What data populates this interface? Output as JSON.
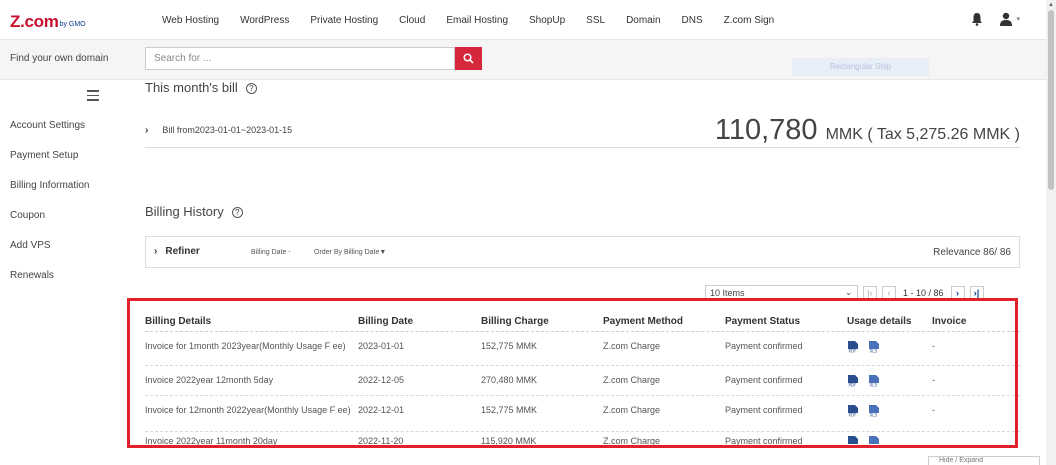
{
  "logo": {
    "main": "Z.com",
    "sub": "by GMO"
  },
  "nav": [
    "Web Hosting",
    "WordPress",
    "Private Hosting",
    "Cloud",
    "Email Hosting",
    "ShopUp",
    "SSL",
    "Domain",
    "DNS",
    "Z.com Sign"
  ],
  "top_icons": {
    "bell": "bell-icon",
    "user": "user-icon"
  },
  "search": {
    "label": "Find your own domain",
    "placeholder": "Search for ...",
    "faded_button": "Rectangular Ship"
  },
  "sidebar": [
    "Account Settings",
    "Payment Setup",
    "Billing Information",
    "Coupon",
    "Add VPS",
    "Renewals"
  ],
  "bill": {
    "title": "This month's bill",
    "range": "Bill from2023-01-01~2023-01-15",
    "amount": "110,780",
    "unit": "MMK ( Tax 5,275.26 MMK )"
  },
  "history": {
    "title": "Billing History",
    "refiner": "Refiner",
    "filter_date": "Billing Date  -",
    "filter_order": "Order By  Billing Date▼",
    "relevance": "Relevance 86/ 86",
    "items_select": "10 Items",
    "page_range": "1 - 10 / 86"
  },
  "table": {
    "headers": [
      "Billing Details",
      "Billing Date",
      "Billing Charge",
      "Payment Method",
      "Payment Status",
      "Usage details",
      "Invoice"
    ],
    "rows": [
      {
        "details": "Invoice for 1month 2023year(Monthly Usage F ee)",
        "date": "2023-01-01",
        "charge": "152,775 MMK",
        "method": "Z.com Charge",
        "status": "Payment confirmed",
        "invoice": "-"
      },
      {
        "details": "Invoice 2022year 12month 5day",
        "date": "2022-12-05",
        "charge": "270,480 MMK",
        "method": "Z.com Charge",
        "status": "Payment confirmed",
        "invoice": "-"
      },
      {
        "details": "Invoice for 12month 2022year(Monthly Usage F ee)",
        "date": "2022-12-01",
        "charge": "152,775 MMK",
        "method": "Z.com Charge",
        "status": "Payment confirmed",
        "invoice": "-"
      },
      {
        "details": "Invoice 2022year 11month 20day",
        "date": "2022-11-20",
        "charge": "115,920 MMK",
        "method": "Z.com Charge",
        "status": "Payment confirmed",
        "invoice": ""
      }
    ]
  },
  "colors": {
    "accent": "#d6263c",
    "highlight": "#e0202a",
    "icon_blue": "#2a4f8f"
  },
  "corner_box": "Hide / Expand"
}
